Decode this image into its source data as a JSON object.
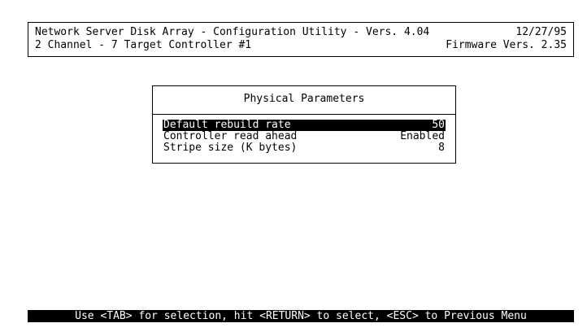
{
  "header": {
    "line1_left": "Network Server Disk Array - Configuration Utility - Vers. 4.04",
    "line1_right": "12/27/95",
    "line2_left": "2 Channel - 7 Target Controller #1",
    "line2_right": "Firmware Vers. 2.35"
  },
  "dialog": {
    "title": "Physical Parameters",
    "params": [
      {
        "label": "Default rebuild rate",
        "value": "50",
        "selected": true
      },
      {
        "label": "Controller read ahead",
        "value": "Enabled",
        "selected": false
      },
      {
        "label": "Stripe size (K bytes)",
        "value": "8",
        "selected": false
      }
    ]
  },
  "status_bar": {
    "text": "Use <TAB> for selection, hit <RETURN> to select, <ESC> to Previous Menu"
  },
  "colors": {
    "background": "#ffffff",
    "foreground": "#000000",
    "highlight_bg": "#000000",
    "highlight_fg": "#ffffff"
  }
}
